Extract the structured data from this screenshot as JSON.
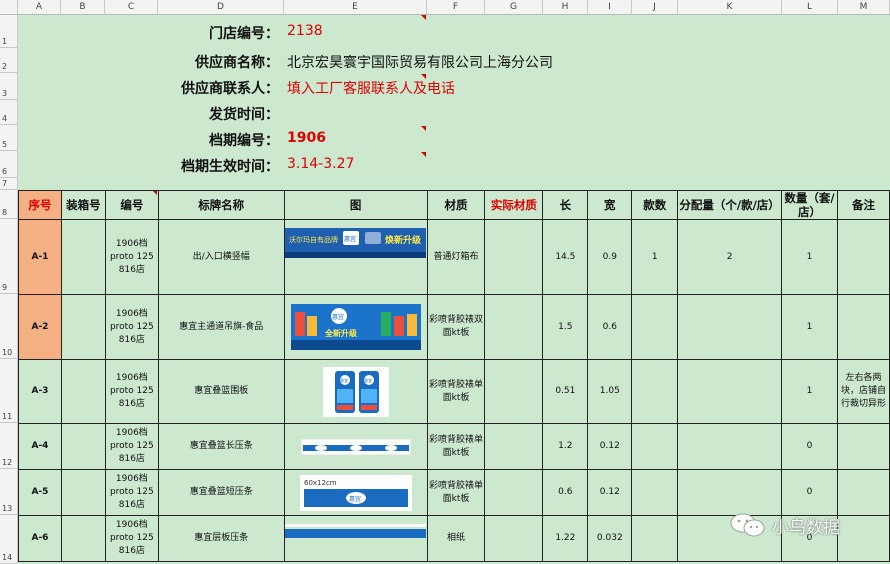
{
  "columns": [
    "A",
    "B",
    "C",
    "D",
    "E",
    "F",
    "G",
    "H",
    "I",
    "J",
    "K",
    "L",
    "M"
  ],
  "row_numbers": [
    "1",
    "2",
    "3",
    "4",
    "5",
    "6",
    "7",
    "8",
    "9",
    "10",
    "11",
    "12",
    "13",
    "14"
  ],
  "info": {
    "store_no": {
      "label": "门店编号：",
      "value": "2138"
    },
    "supplier_name": {
      "label": "供应商名称：",
      "value": "北京宏昊寰宇国际贸易有限公司上海分公司"
    },
    "supplier_contact": {
      "label": "供应商联系人：",
      "value": "填入工厂客服联系人及电话"
    },
    "ship_time": {
      "label": "发货时间：",
      "value": ""
    },
    "schedule_no": {
      "label": "档期编号：",
      "value": "1906"
    },
    "effective_time": {
      "label": "档期生效时间：",
      "value": "3.14-3.27"
    }
  },
  "table": {
    "headers": [
      "序号",
      "装箱号",
      "编号",
      "标牌名称",
      "图",
      "材质",
      "实际材质",
      "长",
      "宽",
      "款数",
      "分配量（个/款/店）",
      "数量（套/店）",
      "备注"
    ],
    "rows": [
      {
        "seq": "A-1",
        "box": "",
        "code": "1906档 proto 125 816店",
        "name": "出/入口横竖幅",
        "material": "普通灯箱布",
        "actual": "",
        "length": "14.5",
        "width": "0.9",
        "styles": "1",
        "alloc": "2",
        "qty": "1",
        "note": ""
      },
      {
        "seq": "A-2",
        "box": "",
        "code": "1906档 proto 125 816店",
        "name": "惠宜主通道吊旗-食品",
        "material": "彩喷背胶裱双面kt板",
        "actual": "",
        "length": "1.5",
        "width": "0.6",
        "styles": "",
        "alloc": "",
        "qty": "1",
        "note": ""
      },
      {
        "seq": "A-3",
        "box": "",
        "code": "1906档 proto 125 816店",
        "name": "惠宜叠篮围板",
        "material": "彩喷背胶裱单面kt板",
        "actual": "",
        "length": "0.51",
        "width": "1.05",
        "styles": "",
        "alloc": "",
        "qty": "1",
        "note": "左右各两块，店铺自行裁切异形"
      },
      {
        "seq": "A-4",
        "box": "",
        "code": "1906档 proto 125 816店",
        "name": "惠宜叠篮长压条",
        "material": "彩喷背胶裱单面kt板",
        "actual": "",
        "length": "1.2",
        "width": "0.12",
        "styles": "",
        "alloc": "",
        "qty": "0",
        "note": ""
      },
      {
        "seq": "A-5",
        "box": "",
        "code": "1906档 proto 125 816店",
        "name": "惠宜叠篮短压条",
        "material": "彩喷背胶裱单面kt板",
        "actual": "",
        "length": "0.6",
        "width": "0.12",
        "styles": "",
        "alloc": "",
        "qty": "0",
        "note": ""
      },
      {
        "seq": "A-6",
        "box": "",
        "code": "1906档 proto 125 816店",
        "name": "惠宜层板压条",
        "material": "相纸",
        "actual": "",
        "length": "1.22",
        "width": "0.032",
        "styles": "",
        "alloc": "",
        "qty": "0",
        "note": ""
      }
    ]
  },
  "images": {
    "a1": {
      "left_text": "沃尔玛自有品牌",
      "brand": "惠宜",
      "right_text": "焕新升级"
    },
    "a2": {
      "brand": "惠宜",
      "big_text": "全新升级"
    },
    "a3": {
      "brand": "惠宜"
    },
    "a5": {
      "size_text": "60x12cm",
      "brand": "惠宜"
    }
  },
  "watermark": {
    "text": "小鸟数据"
  },
  "colors": {
    "sheet_bg": "#cce8cf",
    "highlight_red": "#e00000",
    "seq_orange": "#f4b083",
    "brand_blue": "#1f6fc4"
  }
}
